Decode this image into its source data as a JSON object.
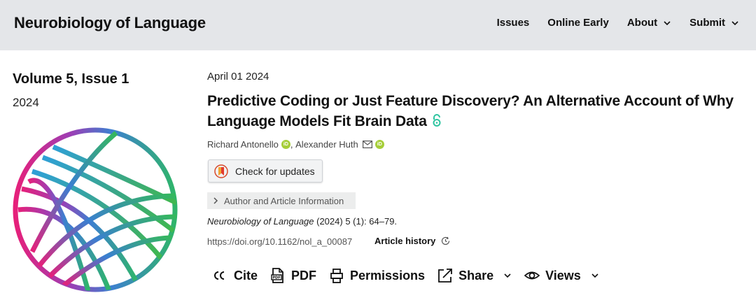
{
  "header": {
    "brand": "Neurobiology of Language",
    "nav": [
      {
        "label": "Issues"
      },
      {
        "label": "Online Early"
      },
      {
        "label": "About"
      },
      {
        "label": "Submit"
      }
    ]
  },
  "issue": {
    "volume": "Volume 5, Issue 1",
    "year": "2024"
  },
  "article": {
    "date": "April 01 2024",
    "title": "Predictive Coding or Just Feature Discovery? An Alternative Account of Why Language Models Fit Brain Data",
    "authors": [
      {
        "name": "Richard Antonello"
      },
      {
        "name": "Alexander Huth"
      }
    ],
    "author_separator": ", ",
    "check_updates_label": "Check for updates",
    "info_label": "Author and Article Information",
    "journal": "Neurobiology of Language",
    "citation_rest": " (2024) 5 (1): 64–79.",
    "doi": "https://doi.org/10.1162/nol_a_00087",
    "history_label": "Article history"
  },
  "toolbar": {
    "cite": "Cite",
    "pdf": "PDF",
    "permissions": "Permissions",
    "share": "Share",
    "views": "Views"
  },
  "icons": {
    "open_access": "open-access-lock-icon",
    "orcid": "orcid-icon",
    "mail": "envelope-icon"
  },
  "colors": {
    "header_bg": "#e4e6e9",
    "orcid_green": "#a6ce39",
    "open_access": "#2ec4a0"
  }
}
